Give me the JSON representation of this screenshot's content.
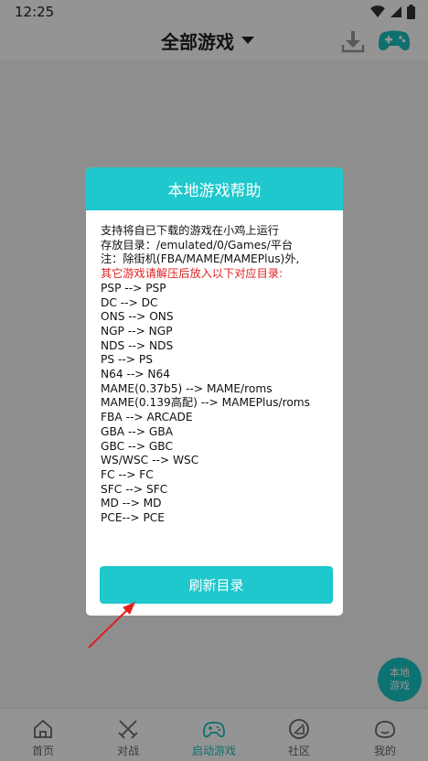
{
  "statusbar": {
    "time": "12:25"
  },
  "header": {
    "title": "全部游戏",
    "icons": [
      "download-icon",
      "gamepad-icon"
    ]
  },
  "fab": {
    "line1": "本地",
    "line2": "游戏"
  },
  "nav": [
    {
      "label": "首页",
      "icon": "home-icon"
    },
    {
      "label": "对战",
      "icon": "swords-icon"
    },
    {
      "label": "启动游戏",
      "icon": "gamepad-icon",
      "active": true
    },
    {
      "label": "社区",
      "icon": "community-icon"
    },
    {
      "label": "我的",
      "icon": "profile-icon"
    }
  ],
  "dialog": {
    "title": "本地游戏帮助",
    "lines": [
      "支持将自已下载的游戏在小鸡上运行",
      "存放目录：/emulated/0/Games/平台",
      "注：除街机(FBA/MAME/MAMEPlus)外,",
      "其它游戏请解压后放入以下对应目录:",
      "PSP --> PSP",
      "DC --> DC",
      "ONS --> ONS",
      "NGP --> NGP",
      "NDS --> NDS",
      "PS --> PS",
      "N64 --> N64",
      "MAME(0.37b5) --> MAME/roms",
      "MAME(0.139高配) --> MAMEPlus/roms",
      "FBA --> ARCADE",
      "GBA --> GBA",
      "GBC --> GBC",
      "WS/WSC --> WSC",
      "FC --> FC",
      "SFC --> SFC",
      "MD --> MD",
      "PCE--> PCE"
    ],
    "refresh_label": "刷新目录"
  },
  "colors": {
    "accent": "#1ec8cc",
    "annotation_red": "#e02020"
  }
}
